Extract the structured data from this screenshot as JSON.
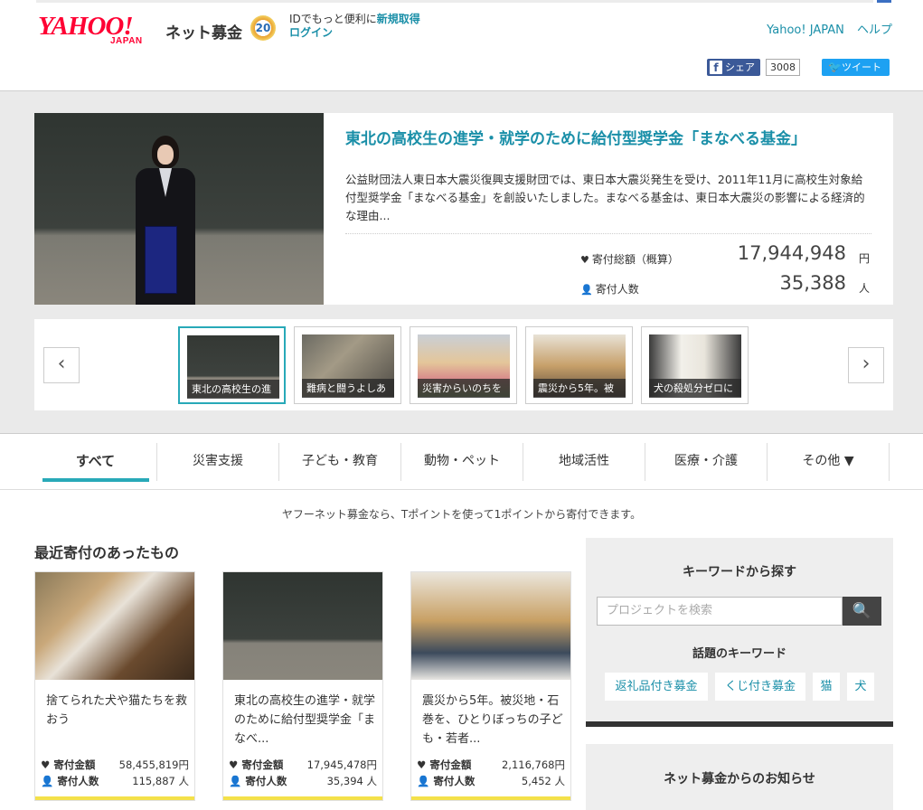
{
  "header": {
    "logo_text": "YAHOO!",
    "logo_sub": "JAPAN",
    "service_name": "ネット募金",
    "anniversary_badge": "20",
    "login_prompt": "IDでもっと便利に",
    "register_link": "新規取得",
    "login_link": "ログイン",
    "links": [
      "Yahoo! JAPAN",
      "ヘルプ"
    ],
    "share_label": "シェア",
    "share_count": "3008",
    "tweet_label": "ツイート"
  },
  "hero": {
    "title": "東北の高校生の進学・就学のために給付型奨学金「まなべる基金」",
    "description": "公益財団法人東日本大震災復興支援財団では、東日本大震災発生を受け、2011年11月に高校生対象給付型奨学金「まなべる基金」を創設いたしました。まなべる基金は、東日本大震災の影響による経済的な理由...",
    "total_label": "寄付総額（概算）",
    "total_value": "17,944,948",
    "total_unit": "円",
    "donors_label": "寄付人数",
    "donors_value": "35,388",
    "donors_unit": "人"
  },
  "carousel": {
    "prev": "‹",
    "next": "›",
    "items": [
      {
        "caption": "東北の高校生の進"
      },
      {
        "caption": "難病と闘うよしあ"
      },
      {
        "caption": "災害からいのちを"
      },
      {
        "caption": "震災から5年。被"
      },
      {
        "caption": "犬の殺処分ゼロに"
      }
    ]
  },
  "tabs": [
    {
      "label": "すべて"
    },
    {
      "label": "災害支援"
    },
    {
      "label": "子ども・教育"
    },
    {
      "label": "動物・ペット"
    },
    {
      "label": "地域活性"
    },
    {
      "label": "医療・介護"
    },
    {
      "label": "その他 ▼"
    }
  ],
  "notice": "ヤフーネット募金なら、Tポイントを使って1ポイントから寄付できます。",
  "recent": {
    "title": "最近寄付のあったもの",
    "amount_label": "寄付金額",
    "count_label": "寄付人数",
    "cards": [
      {
        "title": "捨てられた犬や猫たちを救おう",
        "amount": "58,455,819円",
        "count": "115,887 人"
      },
      {
        "title": "東北の高校生の進学・就学のために給付型奨学金「まなべ...",
        "amount": "17,945,478円",
        "count": "35,394 人"
      },
      {
        "title": "震災から5年。被災地・石巻を、ひとりぼっちの子ども・若者...",
        "amount": "2,116,768円",
        "count": "5,452 人"
      }
    ]
  },
  "sidebar": {
    "search_title": "キーワードから探す",
    "search_placeholder": "プロジェクトを検索",
    "keywords_title": "話題のキーワード",
    "keywords": [
      "返礼品付き募金",
      "くじ付き募金",
      "猫",
      "犬"
    ],
    "news_title": "ネット募金からのお知らせ"
  },
  "colors": {
    "accent": "#28a9b8",
    "link": "#1a8fa8",
    "brand_red": "#ff0033"
  }
}
